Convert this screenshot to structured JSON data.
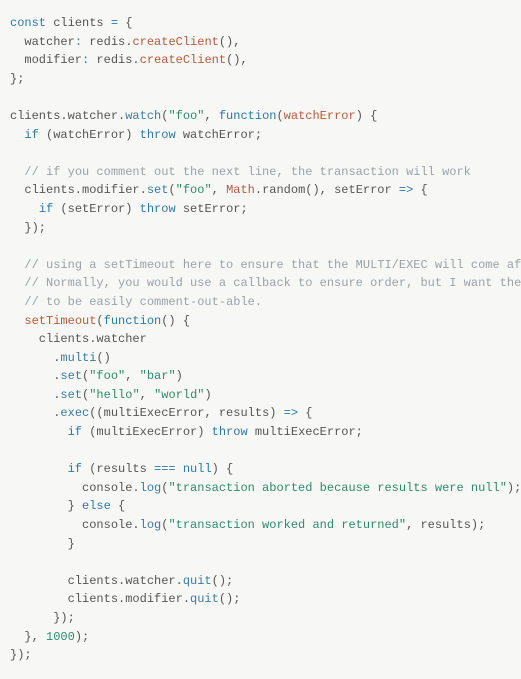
{
  "lines": [
    {
      "indent": 0,
      "segments": [
        [
          "kw",
          "const"
        ],
        [
          "",
          " clients "
        ],
        [
          "kw",
          "="
        ],
        [
          "",
          " {"
        ]
      ]
    },
    {
      "indent": 1,
      "segments": [
        [
          "",
          "watcher"
        ],
        [
          "kw",
          ":"
        ],
        [
          "",
          " redis."
        ],
        [
          "err",
          "createClient"
        ],
        [
          "",
          "(),"
        ]
      ]
    },
    {
      "indent": 1,
      "segments": [
        [
          "",
          "modifier"
        ],
        [
          "kw",
          ":"
        ],
        [
          "",
          " redis."
        ],
        [
          "err",
          "createClient"
        ],
        [
          "",
          "(),"
        ]
      ]
    },
    {
      "indent": 0,
      "segments": [
        [
          "",
          "};"
        ]
      ]
    },
    {
      "indent": 0,
      "segments": [
        [
          "",
          ""
        ]
      ]
    },
    {
      "indent": 0,
      "segments": [
        [
          "",
          "clients.watcher."
        ],
        [
          "prop",
          "watch"
        ],
        [
          "",
          "("
        ],
        [
          "str",
          "\"foo\""
        ],
        [
          "",
          ", "
        ],
        [
          "fn",
          "function"
        ],
        [
          "",
          "("
        ],
        [
          "err",
          "watchError"
        ],
        [
          "",
          ") {"
        ]
      ]
    },
    {
      "indent": 1,
      "segments": [
        [
          "kw",
          "if"
        ],
        [
          "",
          " (watchError) "
        ],
        [
          "kw",
          "throw"
        ],
        [
          "",
          " watchError;"
        ]
      ]
    },
    {
      "indent": 0,
      "segments": [
        [
          "",
          ""
        ]
      ]
    },
    {
      "indent": 1,
      "segments": [
        [
          "cmt",
          "// if you comment out the next line, the transaction will work"
        ]
      ]
    },
    {
      "indent": 1,
      "segments": [
        [
          "",
          "clients.modifier."
        ],
        [
          "prop",
          "set"
        ],
        [
          "",
          "("
        ],
        [
          "str",
          "\"foo\""
        ],
        [
          "",
          ", "
        ],
        [
          "err",
          "Math"
        ],
        [
          "",
          ".random(), setError "
        ],
        [
          "kw",
          "=>"
        ],
        [
          "",
          " {"
        ]
      ]
    },
    {
      "indent": 2,
      "segments": [
        [
          "kw",
          "if"
        ],
        [
          "",
          " (setError) "
        ],
        [
          "kw",
          "throw"
        ],
        [
          "",
          " setError;"
        ]
      ]
    },
    {
      "indent": 1,
      "segments": [
        [
          "",
          "});"
        ]
      ]
    },
    {
      "indent": 0,
      "segments": [
        [
          "",
          ""
        ]
      ]
    },
    {
      "indent": 1,
      "segments": [
        [
          "cmt",
          "// using a setTimeout here to ensure that the MULTI/EXEC will come after the SET."
        ]
      ]
    },
    {
      "indent": 1,
      "segments": [
        [
          "cmt",
          "// Normally, you would use a callback to ensure order, but I want the above SET command"
        ]
      ]
    },
    {
      "indent": 1,
      "segments": [
        [
          "cmt",
          "// to be easily comment-out-able."
        ]
      ]
    },
    {
      "indent": 1,
      "segments": [
        [
          "err",
          "setTimeout"
        ],
        [
          "",
          "("
        ],
        [
          "fn",
          "function"
        ],
        [
          "",
          "() {"
        ]
      ]
    },
    {
      "indent": 2,
      "segments": [
        [
          "",
          "clients.watcher"
        ]
      ]
    },
    {
      "indent": 3,
      "segments": [
        [
          "",
          "."
        ],
        [
          "prop",
          "multi"
        ],
        [
          "",
          "()"
        ]
      ]
    },
    {
      "indent": 3,
      "segments": [
        [
          "",
          "."
        ],
        [
          "prop",
          "set"
        ],
        [
          "",
          "("
        ],
        [
          "str",
          "\"foo\""
        ],
        [
          "",
          ", "
        ],
        [
          "str",
          "\"bar\""
        ],
        [
          "",
          ")"
        ]
      ]
    },
    {
      "indent": 3,
      "segments": [
        [
          "",
          "."
        ],
        [
          "prop",
          "set"
        ],
        [
          "",
          "("
        ],
        [
          "str",
          "\"hello\""
        ],
        [
          "",
          ", "
        ],
        [
          "str",
          "\"world\""
        ],
        [
          "",
          ")"
        ]
      ]
    },
    {
      "indent": 3,
      "segments": [
        [
          "",
          "."
        ],
        [
          "prop",
          "exec"
        ],
        [
          "",
          "((multiExecError, results) "
        ],
        [
          "kw",
          "=>"
        ],
        [
          "",
          " {"
        ]
      ]
    },
    {
      "indent": 4,
      "segments": [
        [
          "kw",
          "if"
        ],
        [
          "",
          " (multiExecError) "
        ],
        [
          "kw",
          "throw"
        ],
        [
          "",
          " multiExecError;"
        ]
      ]
    },
    {
      "indent": 0,
      "segments": [
        [
          "",
          ""
        ]
      ]
    },
    {
      "indent": 4,
      "segments": [
        [
          "kw",
          "if"
        ],
        [
          "",
          " (results "
        ],
        [
          "kw",
          "==="
        ],
        [
          "",
          " "
        ],
        [
          "kw",
          "null"
        ],
        [
          "",
          ") {"
        ]
      ]
    },
    {
      "indent": 5,
      "segments": [
        [
          "",
          "console."
        ],
        [
          "prop",
          "log"
        ],
        [
          "",
          "("
        ],
        [
          "str",
          "\"transaction aborted because results were null\""
        ],
        [
          "",
          ");"
        ]
      ]
    },
    {
      "indent": 4,
      "segments": [
        [
          "",
          "} "
        ],
        [
          "kw",
          "else"
        ],
        [
          "",
          " {"
        ]
      ]
    },
    {
      "indent": 5,
      "segments": [
        [
          "",
          "console."
        ],
        [
          "prop",
          "log"
        ],
        [
          "",
          "("
        ],
        [
          "str",
          "\"transaction worked and returned\""
        ],
        [
          "",
          ", results);"
        ]
      ]
    },
    {
      "indent": 4,
      "segments": [
        [
          "",
          "}"
        ]
      ]
    },
    {
      "indent": 0,
      "segments": [
        [
          "",
          ""
        ]
      ]
    },
    {
      "indent": 4,
      "segments": [
        [
          "",
          "clients.watcher."
        ],
        [
          "prop",
          "quit"
        ],
        [
          "",
          "();"
        ]
      ]
    },
    {
      "indent": 4,
      "segments": [
        [
          "",
          "clients.modifier."
        ],
        [
          "prop",
          "quit"
        ],
        [
          "",
          "();"
        ]
      ]
    },
    {
      "indent": 3,
      "segments": [
        [
          "",
          "});"
        ]
      ]
    },
    {
      "indent": 1,
      "segments": [
        [
          "",
          "}, "
        ],
        [
          "num",
          "1000"
        ],
        [
          "",
          ");"
        ]
      ]
    },
    {
      "indent": 0,
      "segments": [
        [
          "",
          "});"
        ]
      ]
    }
  ],
  "indent_unit": "  "
}
